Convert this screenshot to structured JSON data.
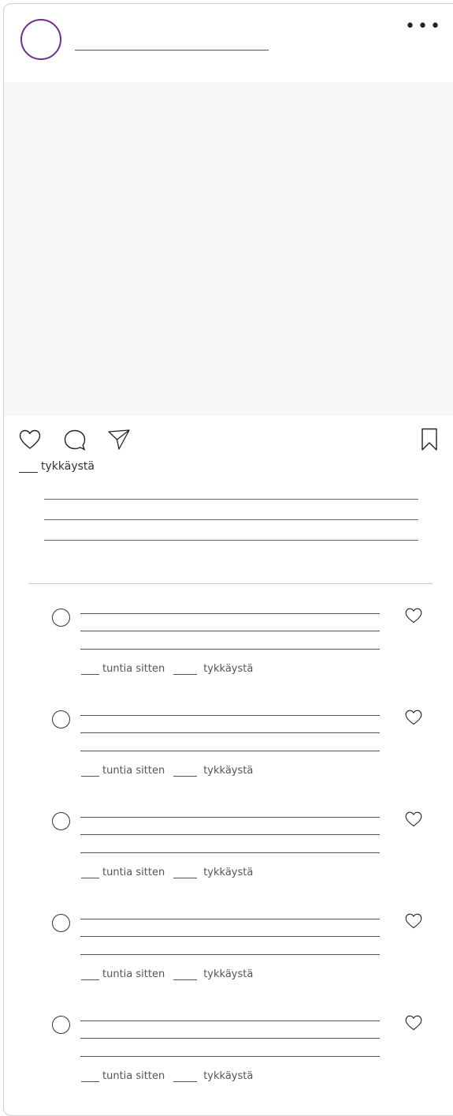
{
  "post": {
    "more_icon": "more-horizontal-icon",
    "actions": [
      "heart-icon",
      "comment-icon",
      "share-icon",
      "bookmark-icon"
    ],
    "likes_text": "tykkäystä",
    "accent_color": "#6b2f8e"
  },
  "comments": [
    {
      "time_text": "tuntia sitten",
      "likes_text": "tykkäystä"
    },
    {
      "time_text": "tuntia sitten",
      "likes_text": "tykkäystä"
    },
    {
      "time_text": "tuntia sitten",
      "likes_text": "tykkäystä"
    },
    {
      "time_text": "tuntia sitten",
      "likes_text": "tykkäystä"
    },
    {
      "time_text": "tuntia sitten",
      "likes_text": "tykkäystä"
    }
  ]
}
